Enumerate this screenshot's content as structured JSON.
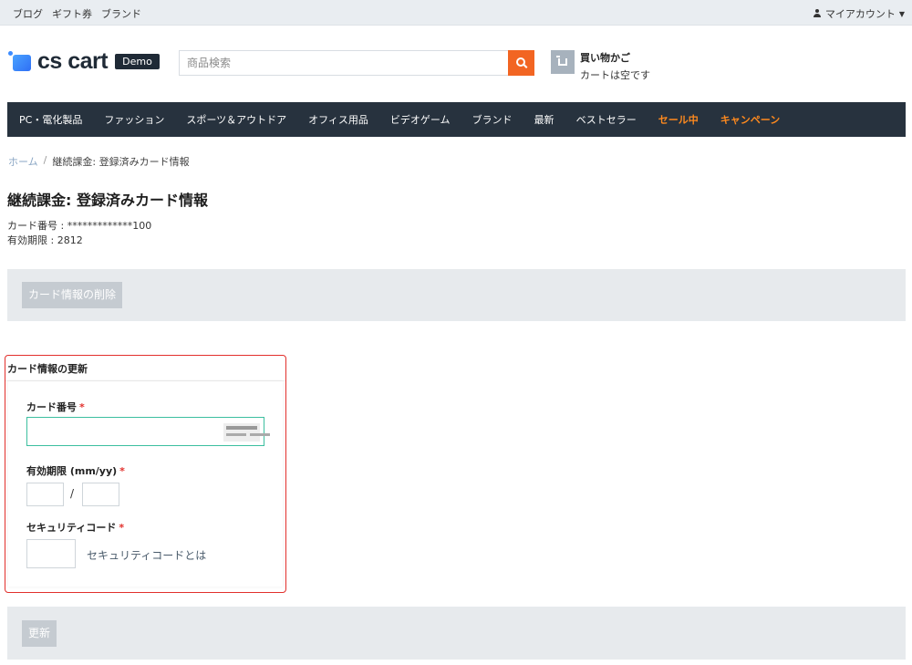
{
  "topbar": {
    "links": [
      "ブログ",
      "ギフト券",
      "ブランド"
    ],
    "account_label": "マイアカウント"
  },
  "header": {
    "logo_text": "cs cart",
    "demo_badge": "Demo",
    "search_placeholder": "商品検索",
    "cart_title": "買い物かご",
    "cart_status": "カートは空です"
  },
  "nav": {
    "items": [
      "PC・電化製品",
      "ファッション",
      "スポーツ＆アウトドア",
      "オフィス用品",
      "ビデオゲーム",
      "ブランド",
      "最新",
      "ベストセラー"
    ],
    "hot_items": [
      "セール中",
      "キャンペーン"
    ],
    "hot_color": "#ff8a1e"
  },
  "breadcrumb": {
    "home": "ホーム",
    "separator": "/",
    "current": "継続課金: 登録済みカード情報"
  },
  "page": {
    "title": "継続課金: 登録済みカード情報",
    "card_number_line": "カード番号 : *************100",
    "expiry_line": "有効期限 : 2812",
    "delete_button": "カード情報の削除"
  },
  "update_form": {
    "heading": "カード情報の更新",
    "card_number_label": "カード番号",
    "expiry_label": "有効期限 (mm/yy)",
    "expiry_separator": "/",
    "security_label": "セキュリティコード",
    "security_help_link": "セキュリティコードとは",
    "required_mark": "*",
    "update_button": "更新"
  },
  "colors": {
    "nav_bg": "#27323e",
    "search_button": "#f26522",
    "highlight_border": "#e2302c",
    "card_input_border": "#3cbf9f"
  }
}
